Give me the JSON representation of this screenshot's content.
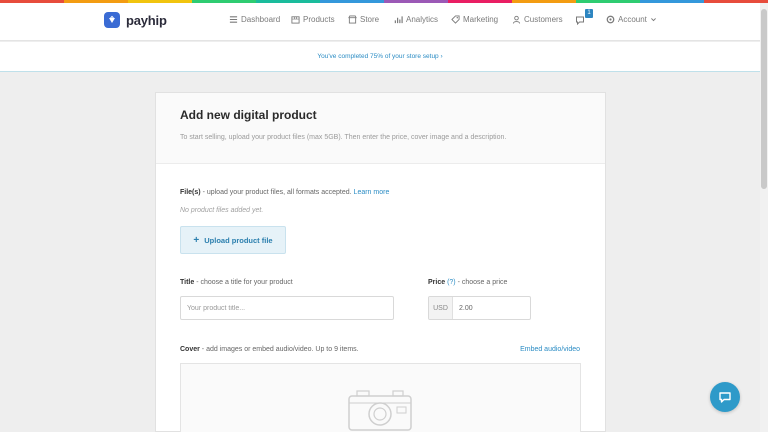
{
  "brand": {
    "name": "payhip"
  },
  "rainbow_colors": [
    "#e74c3c",
    "#f39c12",
    "#f1c40f",
    "#2ecc71",
    "#1abc9c",
    "#3498db",
    "#9b59b6",
    "#e91e63",
    "#f39c12",
    "#2ecc71",
    "#3498db",
    "#e74c3c"
  ],
  "nav": {
    "items": [
      {
        "label": "Dashboard",
        "icon": "list-icon"
      },
      {
        "label": "Products",
        "icon": "box-icon"
      },
      {
        "label": "Store",
        "icon": "store-icon"
      },
      {
        "label": "Analytics",
        "icon": "chart-icon"
      },
      {
        "label": "Marketing",
        "icon": "tag-icon"
      },
      {
        "label": "Customers",
        "icon": "user-icon"
      }
    ],
    "notifications_count": "1",
    "account_label": "Account"
  },
  "setup_banner": {
    "text": "You've completed 75% of your store setup ›"
  },
  "form": {
    "title": "Add new digital product",
    "subtitle": "To start selling, upload your product files (max 5GB). Then enter the price, cover image and a description.",
    "files": {
      "label_bold": "File(s)",
      "label_rest": " - upload your product files, all formats accepted. ",
      "learn_more": "Learn more",
      "empty_text": "No product files added yet.",
      "upload_button": "Upload product file"
    },
    "title_field": {
      "label_bold": "Title",
      "label_rest": " - choose a title for your product",
      "placeholder": "Your product title..."
    },
    "price_field": {
      "label_bold": "Price",
      "help": "(?)",
      "label_rest": " - choose a price",
      "currency": "USD",
      "value": "2.00"
    },
    "cover": {
      "label_bold": "Cover",
      "label_rest": " - add images or embed audio/video. Up to 9 items.",
      "embed_link": "Embed audio/video"
    }
  },
  "colors": {
    "accent": "#2b8cc4",
    "help_button": "#2e9ac9",
    "brand_icon": "#3a6bd4"
  }
}
